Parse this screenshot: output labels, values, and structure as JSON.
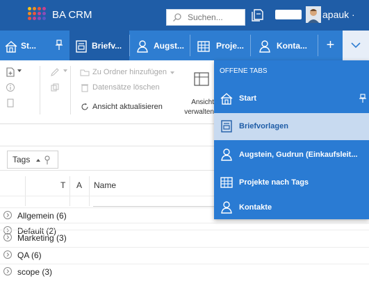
{
  "topbar": {
    "app_title": "BA CRM",
    "search_placeholder": "Suchen...",
    "username": "apauk",
    "username_suffix": "·"
  },
  "tabs": [
    {
      "label": "St...",
      "icon": "home-icon"
    },
    {
      "label": "Briefv...",
      "icon": "template-icon"
    },
    {
      "label": "Augst...",
      "icon": "contact-icon"
    },
    {
      "label": "Proje...",
      "icon": "projects-icon"
    },
    {
      "label": "Konta...",
      "icon": "contact-icon"
    }
  ],
  "tabbar": {
    "add_label": "+"
  },
  "ribbon": {
    "move_to_folder": "Zu Ordner hinzufügen",
    "delete_records": "Datensätze löschen",
    "refresh_view": "Ansicht aktualisieren",
    "view_manage_line1": "Ansicht",
    "view_manage_line2": "verwalten"
  },
  "filter": {
    "tags_label": "Tags"
  },
  "table": {
    "columns": [
      "T",
      "A",
      "Name"
    ]
  },
  "groups": [
    "Allgemein (6)",
    "Default (2)",
    "Marketing (3)",
    "QA (6)",
    "scope (3)"
  ],
  "open_tabs": {
    "title": "OFFENE TABS",
    "items": [
      {
        "label": "Start",
        "icon": "home-icon"
      },
      {
        "label": "Briefvorlagen",
        "icon": "template-icon"
      },
      {
        "label": "Augstein, Gudrun (Einkaufsleit...",
        "icon": "contact-icon"
      },
      {
        "label": "Projekte nach Tags",
        "icon": "projects-icon"
      },
      {
        "label": "Kontakte",
        "icon": "contact-icon"
      }
    ]
  },
  "colors": {
    "topbar": "#1f5da7",
    "tabbar": "#2e7dd1",
    "dropdown": "#2a7bd3",
    "selected": "#c8daf0"
  }
}
